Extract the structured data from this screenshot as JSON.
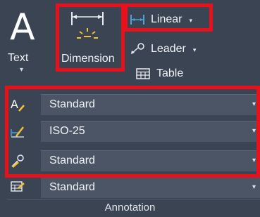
{
  "panel": {
    "title": "Annotation"
  },
  "text_tool": {
    "glyph": "A",
    "label": "Text",
    "caret": "▾"
  },
  "dimension_tool": {
    "label": "Dimension"
  },
  "linear_tool": {
    "label": "Linear",
    "dropdown": "▾"
  },
  "leader_tool": {
    "label": "Leader",
    "dropdown": "▾"
  },
  "table_tool": {
    "label": "Table"
  },
  "styles": {
    "text_style": "Standard",
    "dimension_style": "ISO-25",
    "multileader_style": "Standard",
    "table_style": "Standard",
    "arrow": "▾"
  },
  "colors": {
    "background": "#3b4453",
    "field": "#4b5566",
    "highlight": "#e8101a",
    "accent_blue": "#4aa3df",
    "accent_yellow": "#f2c230"
  }
}
